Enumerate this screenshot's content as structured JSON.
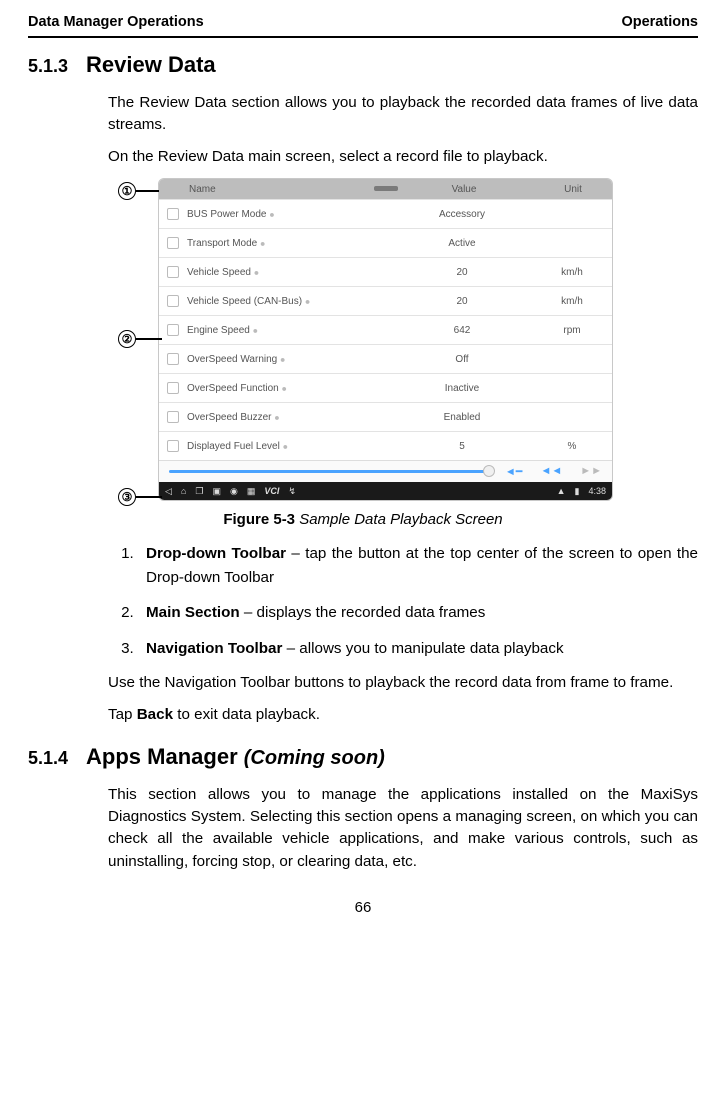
{
  "header": {
    "left": "Data Manager Operations",
    "right": "Operations"
  },
  "section1": {
    "num": "5.1.3",
    "title": "Review Data"
  },
  "section2": {
    "num": "5.1.4",
    "title": "Apps Manager ",
    "suffix": "(Coming soon)"
  },
  "p1": "The Review Data section allows you to playback the recorded data frames of live data streams.",
  "p2": "On the Review Data main screen, select a record file to playback.",
  "figcaption": {
    "label": "Figure 5-3",
    "text": " Sample Data Playback Screen"
  },
  "list": {
    "i1": {
      "bold": "Drop-down Toolbar",
      "rest": " – tap the button at the top center of the screen to open the Drop-down Toolbar"
    },
    "i2": {
      "bold": "Main Section",
      "rest": " – displays the recorded data frames"
    },
    "i3": {
      "bold": "Navigation Toolbar",
      "rest": " – allows you to manipulate data playback"
    }
  },
  "p3": "Use the Navigation Toolbar buttons to playback the record data from frame to frame.",
  "p4a": "Tap ",
  "p4b": "Back",
  "p4c": " to exit data playback.",
  "p5": "This section allows you to manage the applications installed on the MaxiSys Diagnostics System. Selecting this section opens a managing screen, on which you can check all the available vehicle applications, and make various controls, such as uninstalling, forcing stop, or clearing data, etc.",
  "pagenum": "66",
  "callouts": {
    "c1": "①",
    "c2": "②",
    "c3": "③"
  },
  "screenshot": {
    "headers": {
      "name": "Name",
      "value": "Value",
      "unit": "Unit"
    },
    "rows": [
      {
        "name": "BUS Power Mode ",
        "value": "Accessory",
        "unit": ""
      },
      {
        "name": "Transport Mode ",
        "value": "Active",
        "unit": ""
      },
      {
        "name": "Vehicle Speed ",
        "value": "20",
        "unit": "km/h"
      },
      {
        "name": "Vehicle Speed (CAN-Bus) ",
        "value": "20",
        "unit": "km/h"
      },
      {
        "name": "Engine Speed ",
        "value": "642",
        "unit": "rpm"
      },
      {
        "name": "OverSpeed Warning ",
        "value": "Off",
        "unit": ""
      },
      {
        "name": "OverSpeed Function ",
        "value": "Inactive",
        "unit": ""
      },
      {
        "name": "OverSpeed Buzzer ",
        "value": "Enabled",
        "unit": ""
      },
      {
        "name": "Displayed Fuel Level ",
        "value": "5",
        "unit": "%"
      }
    ],
    "clock": "4:38"
  }
}
